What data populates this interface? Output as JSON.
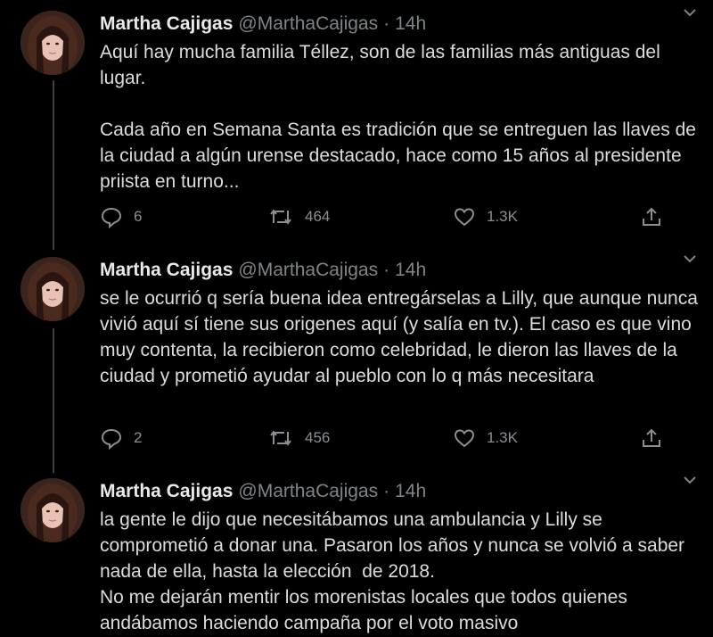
{
  "tweets": [
    {
      "name": "Martha Cajigas",
      "handle": "@MarthaCajigas",
      "dot": "·",
      "time": "14h",
      "text": "Aquí hay mucha familia Téllez, son de las familias más antiguas del lugar.\n\nCada año en Semana Santa es tradición que se entreguen las llaves de la ciudad a algún urense destacado, hace como 15 años al presidente priista en turno...",
      "replies": "6",
      "retweets": "464",
      "likes": "1.3K"
    },
    {
      "name": "Martha Cajigas",
      "handle": "@MarthaCajigas",
      "dot": "·",
      "time": "14h",
      "text": "se le ocurrió q sería buena idea entregárselas a Lilly, que aunque nunca vivió aquí sí tiene sus origenes aquí (y salía en tv.). El caso es que vino muy contenta, la recibieron como celebridad, le dieron las llaves de la ciudad y prometió ayudar al pueblo con lo q más necesitara",
      "replies": "2",
      "retweets": "456",
      "likes": "1.3K"
    },
    {
      "name": "Martha Cajigas",
      "handle": "@MarthaCajigas",
      "dot": "·",
      "time": "14h",
      "text": "la gente le dijo que necesitábamos una ambulancia y Lilly se comprometió a donar una. Pasaron los años y nunca se volvió a saber nada de ella, hasta la elección  de 2018.\nNo me dejarán mentir los morenistas locales que todos quienes andábamos haciendo campaña por el voto masivo"
    }
  ],
  "colors": {
    "background": "#000000",
    "text": "#dcdcdc",
    "muted": "#7f8488",
    "thread_line": "#3d4145"
  },
  "icons": [
    "reply-icon",
    "retweet-icon",
    "like-icon",
    "share-icon",
    "chevron-down-icon"
  ]
}
